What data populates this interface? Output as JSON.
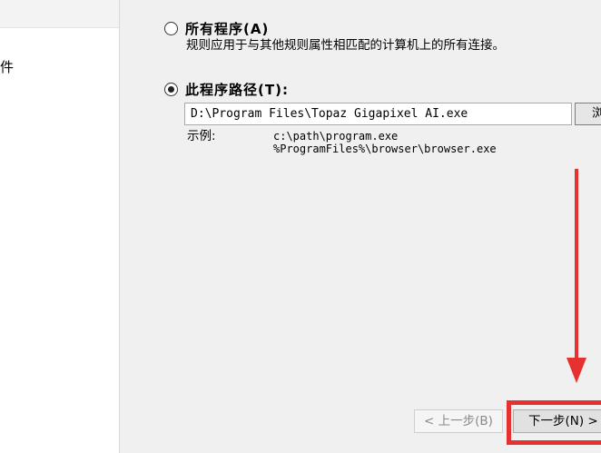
{
  "sidebar": {
    "partial_item": "件"
  },
  "rules": {
    "all_programs": {
      "label": "所有程序(A)",
      "description": "规则应用于与其他规则属性相匹配的计算机上的所有连接。",
      "selected": false
    },
    "this_program": {
      "label": "此程序路径(T):",
      "selected": true,
      "path_value": "D:\\Program Files\\Topaz Gigapixel AI.exe",
      "browse_label": "浏"
    }
  },
  "example": {
    "label": "示例:",
    "line1": "c:\\path\\program.exe",
    "line2": "%ProgramFiles%\\browser\\browser.exe"
  },
  "footer": {
    "back_label": "< 上一步(B)",
    "next_label": "下一步(N) >"
  },
  "annotation": {
    "color": "#e5312f"
  }
}
